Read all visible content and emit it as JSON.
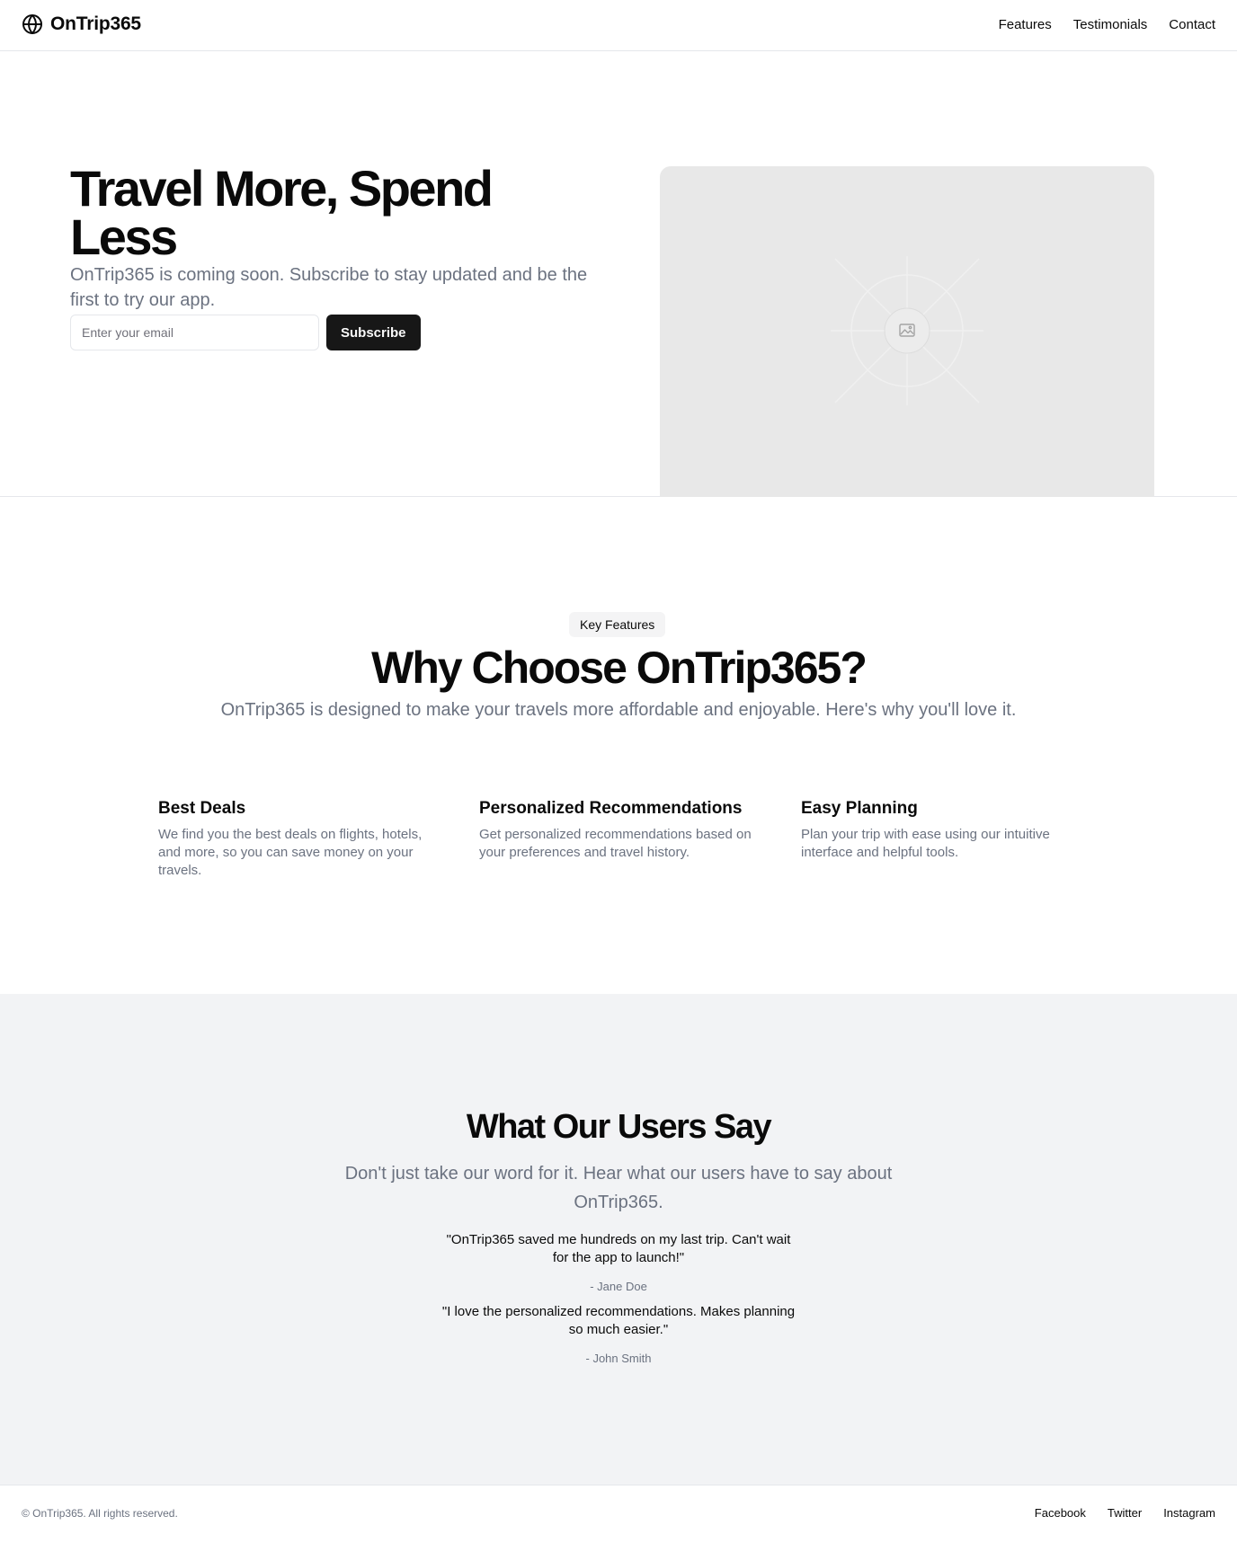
{
  "header": {
    "brand": "OnTrip365",
    "brand_icon": "globe-icon",
    "nav": [
      {
        "label": "Features"
      },
      {
        "label": "Testimonials"
      },
      {
        "label": "Contact"
      }
    ]
  },
  "hero": {
    "title": "Travel More, Spend Less",
    "subtitle": "OnTrip365 is coming soon. Subscribe to stay updated and be the first to try our app.",
    "email_placeholder": "Enter your email",
    "email_value": "",
    "subscribe_label": "Subscribe",
    "image_icon": "image-placeholder-icon"
  },
  "features": {
    "badge": "Key Features",
    "title": "Why Choose OnTrip365?",
    "subtitle": "OnTrip365 is designed to make your travels more affordable and enjoyable. Here's why you'll love it.",
    "items": [
      {
        "title": "Best Deals",
        "text": "We find you the best deals on flights, hotels, and more, so you can save money on your travels."
      },
      {
        "title": "Personalized Recommendations",
        "text": "Get personalized recommendations based on your preferences and travel history."
      },
      {
        "title": "Easy Planning",
        "text": "Plan your trip with ease using our intuitive interface and helpful tools."
      }
    ]
  },
  "testimonials": {
    "title": "What Our Users Say",
    "subtitle": "Don't just take our word for it. Hear what our users have to say about OnTrip365.",
    "items": [
      {
        "quote": "\"OnTrip365 saved me hundreds on my last trip. Can't wait for the app to launch!\"",
        "author": "- Jane Doe"
      },
      {
        "quote": "\"I love the personalized recommendations. Makes planning so much easier.\"",
        "author": "- John Smith"
      }
    ]
  },
  "footer": {
    "copyright": "© OnTrip365. All rights reserved.",
    "links": [
      {
        "label": "Facebook"
      },
      {
        "label": "Twitter"
      },
      {
        "label": "Instagram"
      }
    ]
  },
  "colors": {
    "accent_button": "#171717",
    "muted_text": "#6b7280",
    "testimonial_bg": "#f2f3f5",
    "image_placeholder_bg": "#e8e8e8"
  }
}
